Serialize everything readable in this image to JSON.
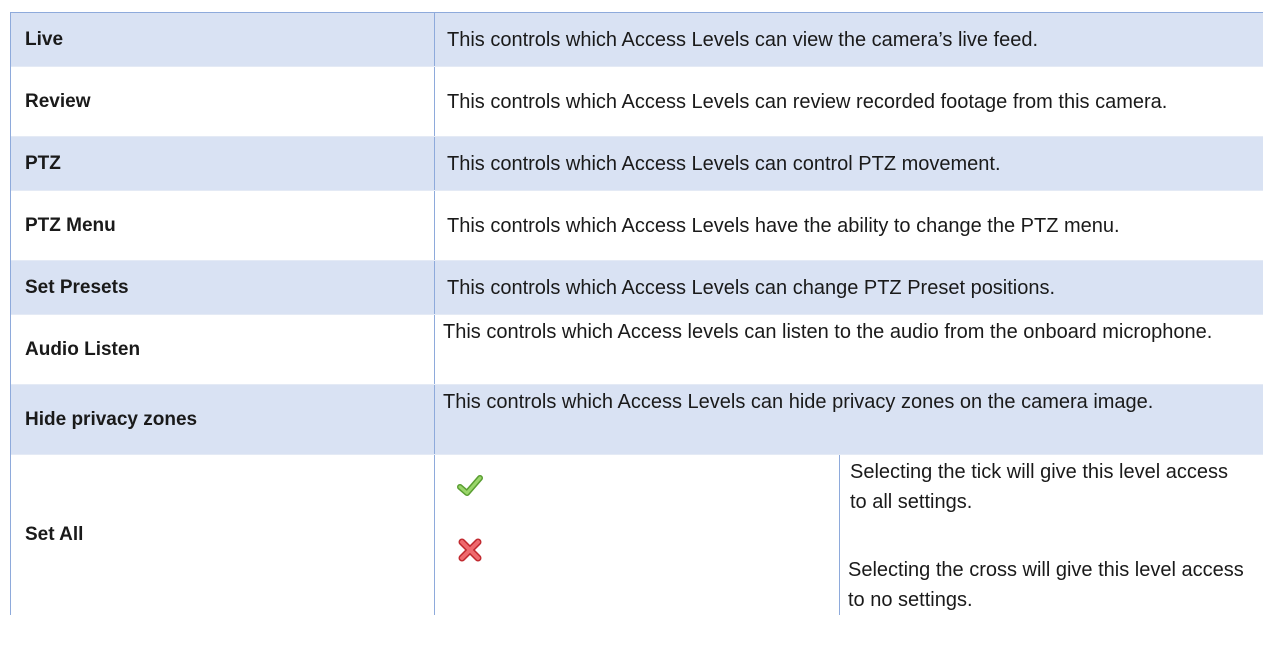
{
  "rows": [
    {
      "label": "Live",
      "desc": "This controls which Access Levels can view the camera’s live feed."
    },
    {
      "label": "Review",
      "desc": "This controls which Access Levels can review recorded footage from this camera."
    },
    {
      "label": "PTZ",
      "desc": "This controls which Access Levels can control PTZ movement."
    },
    {
      "label": "PTZ Menu",
      "desc": "This controls which Access Levels have the ability to change the PTZ menu."
    },
    {
      "label": "Set Presets",
      "desc": "This controls which Access Levels can change PTZ Preset positions."
    },
    {
      "label": "Audio Listen",
      "desc": "This controls which Access levels can listen to the audio from the onboard microphone."
    },
    {
      "label": "Hide privacy zones",
      "desc": "This controls which Access Levels can hide privacy zones on the camera image."
    }
  ],
  "set_all": {
    "label": "Set All",
    "tick_note": "Selecting the tick will give this level access to all settings.",
    "cross_note": "Selecting the cross will give this level access to no settings."
  },
  "icons": {
    "tick": "checkmark-icon",
    "cross": "cross-icon"
  },
  "colors": {
    "row_shade": "#d9e2f3",
    "border": "#8eaadb",
    "tick": "#7cc04b",
    "cross": "#e0454b"
  }
}
